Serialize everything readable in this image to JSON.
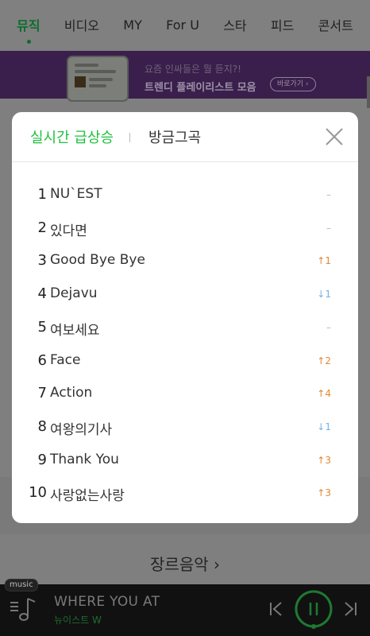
{
  "nav": {
    "tabs": [
      "뮤직",
      "비디오",
      "MY",
      "For U",
      "스타",
      "피드",
      "콘서트"
    ],
    "active_index": 0
  },
  "banner": {
    "line1": "요즘 인싸들은 뭘 듣지?!",
    "line2": "트렌디 플레이리스트 모음",
    "button": "바로가기 ›"
  },
  "modal": {
    "tab_active": "실시간 급상승",
    "tab_inactive": "방금그곡",
    "rows": [
      {
        "rank": "1",
        "title": "NU`EST",
        "change": "–",
        "dir": "same"
      },
      {
        "rank": "2",
        "title": "있다면",
        "change": "–",
        "dir": "same"
      },
      {
        "rank": "3",
        "title": "Good Bye Bye",
        "change": "↑1",
        "dir": "up"
      },
      {
        "rank": "4",
        "title": "Dejavu",
        "change": "↓1",
        "dir": "down"
      },
      {
        "rank": "5",
        "title": "여보세요",
        "change": "–",
        "dir": "same"
      },
      {
        "rank": "6",
        "title": "Face",
        "change": "↑2",
        "dir": "up"
      },
      {
        "rank": "7",
        "title": "Action",
        "change": "↑4",
        "dir": "up"
      },
      {
        "rank": "8",
        "title": "여왕의기사",
        "change": "↓1",
        "dir": "down"
      },
      {
        "rank": "9",
        "title": "Thank You",
        "change": "↑3",
        "dir": "up"
      },
      {
        "rank": "10",
        "title": "사랑없는사랑",
        "change": "↑3",
        "dir": "up"
      }
    ]
  },
  "genre": "장르음악 ›",
  "player": {
    "badge": "music",
    "title": "WHERE YOU AT",
    "artist": "뉴이스트 W"
  },
  "colors": {
    "accent_green": "#1ec13d",
    "up": "#e4882e",
    "down": "#73b3e6"
  }
}
